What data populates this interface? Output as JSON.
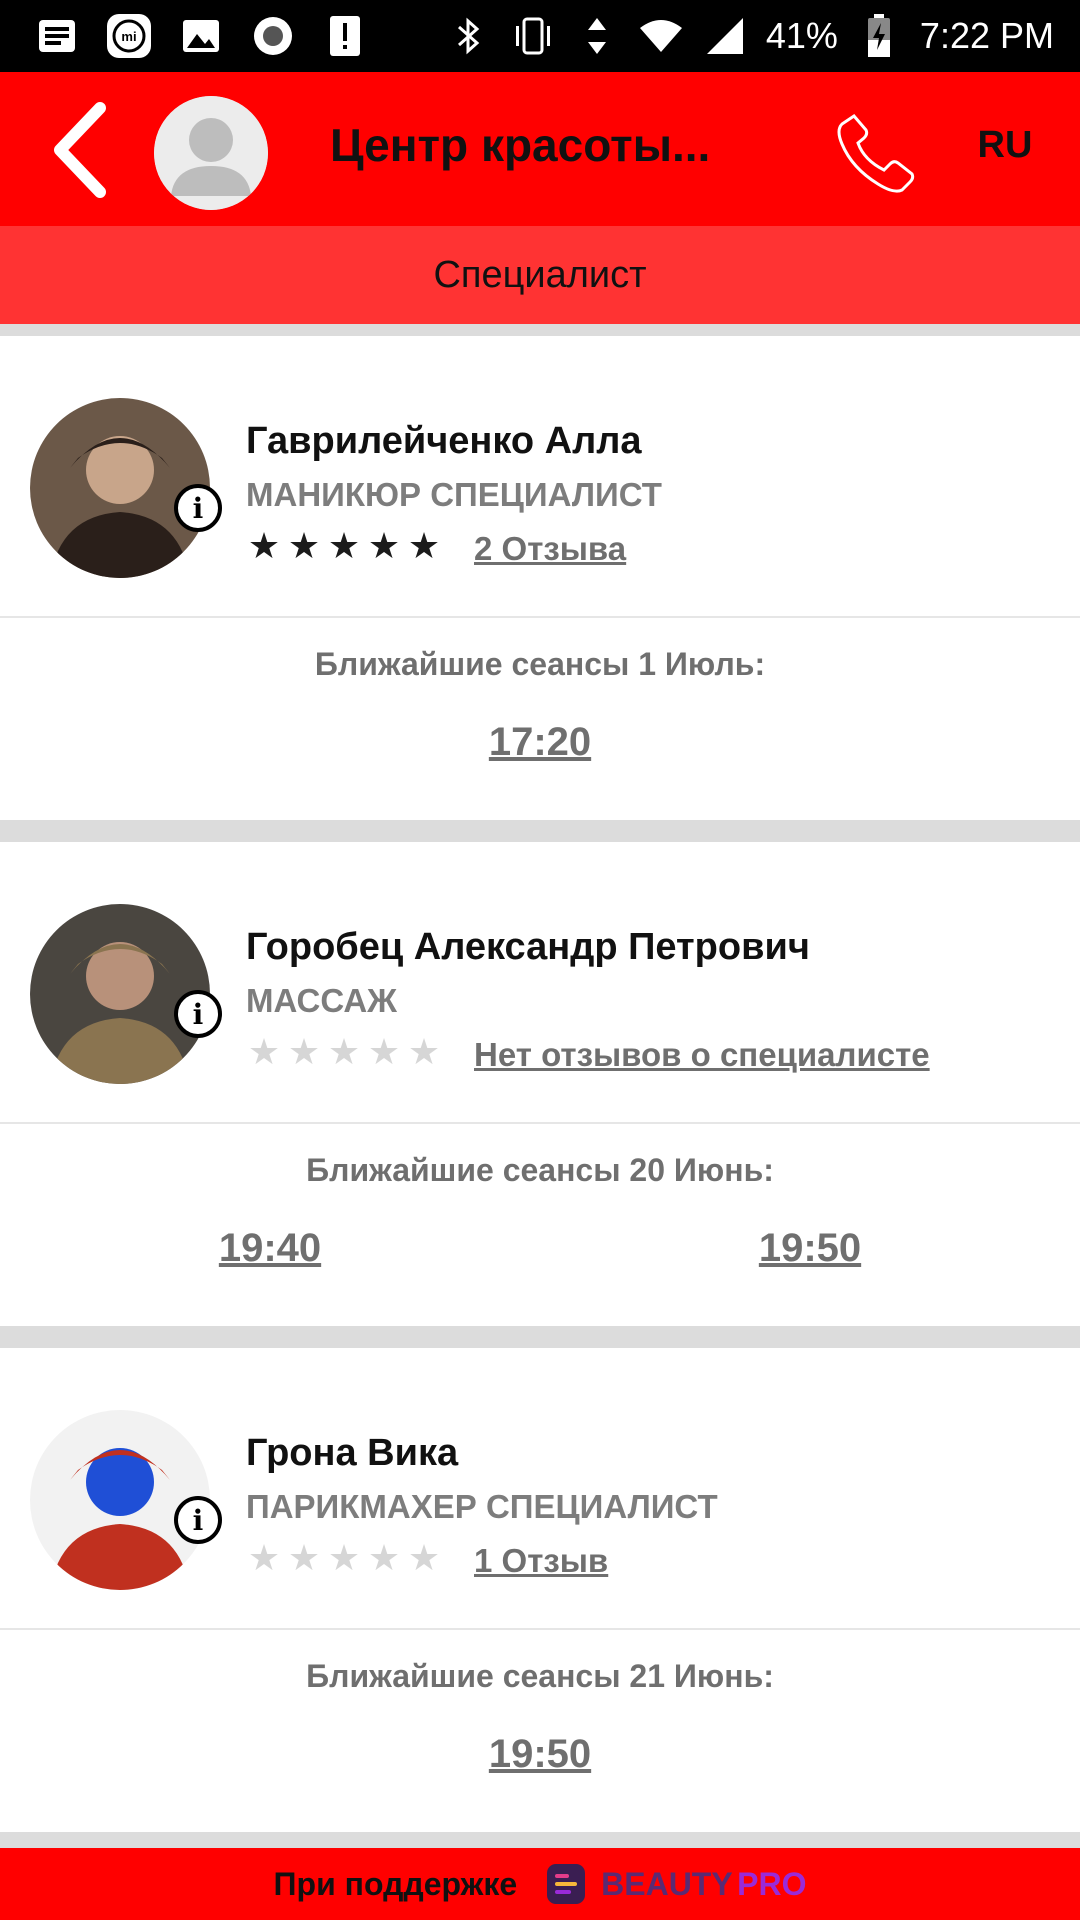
{
  "status_bar": {
    "battery": "41%",
    "time": "7:22 PM",
    "icons_left": [
      "notes-icon",
      "mi-icon",
      "image-icon",
      "record-icon",
      "alert-icon"
    ],
    "icons_right": [
      "bluetooth-icon",
      "vibrate-icon",
      "data-arrows-icon",
      "wifi-icon",
      "signal-icon",
      "battery-icon"
    ]
  },
  "header": {
    "title": "Центр красоты...",
    "lang": "RU",
    "subtitle": "Специалист"
  },
  "specialists": [
    {
      "name": "Гаврилейченко Алла",
      "role": "МАНИКЮР СПЕЦИАЛИСТ",
      "rating": 5,
      "reviews": "2 Отзыва",
      "sessions_label": "Ближайшие сеансы  1 Июль:",
      "slots": [
        "17:20"
      ],
      "photo_colors": [
        "#6b5848",
        "#2a1f1a",
        "#c8a58a"
      ]
    },
    {
      "name": "Горобец Александр Петрович",
      "role": "МАССАЖ",
      "rating": 0,
      "reviews": "Нет отзывов о специалисте",
      "sessions_label": "Ближайшие сеансы  20 Июнь:",
      "slots": [
        "19:40",
        "19:50"
      ],
      "photo_colors": [
        "#4a4640",
        "#8a7450",
        "#b8917a"
      ]
    },
    {
      "name": "Грона Вика",
      "role": "ПАРИКМАХЕР СПЕЦИАЛИСТ",
      "rating": 0,
      "reviews": "1 Отзыв",
      "sessions_label": "Ближайшие сеансы  21 Июнь:",
      "slots": [
        "19:50"
      ],
      "photo_colors": [
        "#f2f2f2",
        "#c0301f",
        "#1f4fd6"
      ]
    }
  ],
  "footer": {
    "text": "При поддержке",
    "brand_part1": "BEAUTY",
    "brand_part2": "PRO"
  },
  "colors": {
    "primary": "#ff0000",
    "subheader": "#ff3333",
    "muted_text": "#6f6f6f"
  }
}
